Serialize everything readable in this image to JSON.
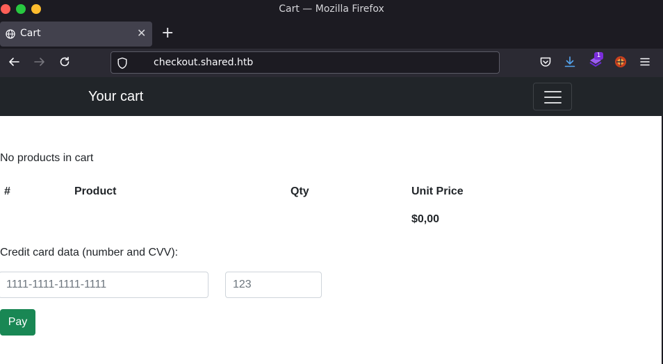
{
  "window": {
    "title": "Cart — Mozilla Firefox"
  },
  "tab": {
    "label": "Cart",
    "close_glyph": "✕",
    "new_tab_glyph": "+"
  },
  "toolbar": {
    "url": "checkout.shared.htb",
    "extension_badge": "1"
  },
  "colors": {
    "navbar": "#212529",
    "pay_button": "#198754",
    "browser_chrome": "#1c1b22"
  },
  "page": {
    "brand": "Your cart",
    "empty_message": "No products in cart",
    "table": {
      "headers": [
        "#",
        "Product",
        "Qty",
        "Unit Price"
      ],
      "total": "$0,00"
    },
    "cc_label": "Credit card data (number and CVV):",
    "card_number_placeholder": "1111-1111-1111-1111",
    "cvv_placeholder": "123",
    "pay_label": "Pay"
  }
}
